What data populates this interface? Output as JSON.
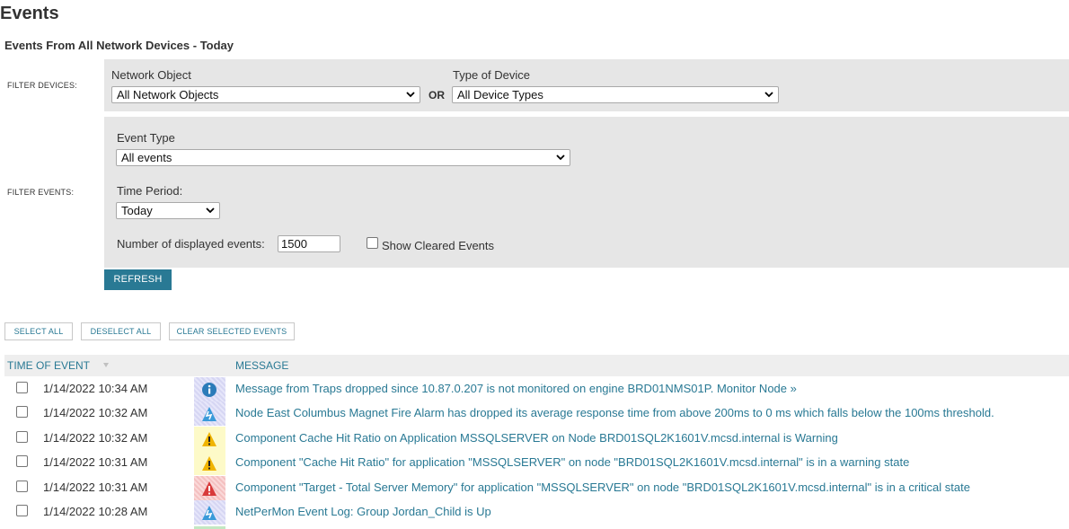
{
  "page": {
    "title": "Events",
    "subtitle": "Events From All Network Devices - Today"
  },
  "filter_devices": {
    "label": "FILTER DEVICES:",
    "network_object": {
      "label": "Network Object",
      "value": "All Network Objects"
    },
    "or_label": "OR",
    "device_type": {
      "label": "Type of Device",
      "value": "All Device Types"
    }
  },
  "filter_events": {
    "label": "FILTER EVENTS:",
    "event_type": {
      "label": "Event Type",
      "value": "All events"
    },
    "time_period": {
      "label": "Time Period:",
      "value": "Today"
    },
    "num_events": {
      "label": "Number of displayed events:",
      "value": "1500"
    },
    "show_cleared": {
      "label": "Show Cleared Events",
      "checked": false
    }
  },
  "buttons": {
    "refresh": "REFRESH",
    "select_all": "SELECT ALL",
    "deselect_all": "DESELECT ALL",
    "clear_selected": "CLEAR SELECTED EVENTS"
  },
  "table": {
    "columns": {
      "time": "TIME OF EVENT",
      "message": "MESSAGE"
    },
    "rows": [
      {
        "time": "1/14/2022 10:34 AM",
        "icon": "info-icon",
        "severity_color": "#dcdcf7",
        "message": "Message from Traps dropped since 10.87.0.207 is not monitored on engine BRD01NMS01P. Monitor Node »"
      },
      {
        "time": "1/14/2022 10:32 AM",
        "icon": "node-change-icon",
        "severity_color": "#dcdcf7",
        "message": "Node East Columbus Magnet Fire Alarm has dropped its average response time from above 200ms to 0 ms which falls below the 100ms threshold."
      },
      {
        "time": "1/14/2022 10:32 AM",
        "icon": "warning-icon",
        "severity_color": "#fdfac8",
        "message": "Component Cache Hit Ratio on Application MSSQLSERVER on Node BRD01SQL2K1601V.mcsd.internal is Warning"
      },
      {
        "time": "1/14/2022 10:31 AM",
        "icon": "warning-icon",
        "severity_color": "#fdfac8",
        "message": "Component \"Cache Hit Ratio\" for application \"MSSQLSERVER\" on node \"BRD01SQL2K1601V.mcsd.internal\" is in a warning state"
      },
      {
        "time": "1/14/2022 10:31 AM",
        "icon": "critical-icon",
        "severity_color": "#f9d0d0",
        "message": "Component \"Target - Total Server Memory\" for application \"MSSQLSERVER\" on node \"BRD01SQL2K1601V.mcsd.internal\" is in a critical state"
      },
      {
        "time": "1/14/2022 10:28 AM",
        "icon": "node-change-icon",
        "severity_color": "#dcdcf7",
        "message": "NetPerMon Event Log: Group Jordan_Child is Up"
      }
    ]
  }
}
